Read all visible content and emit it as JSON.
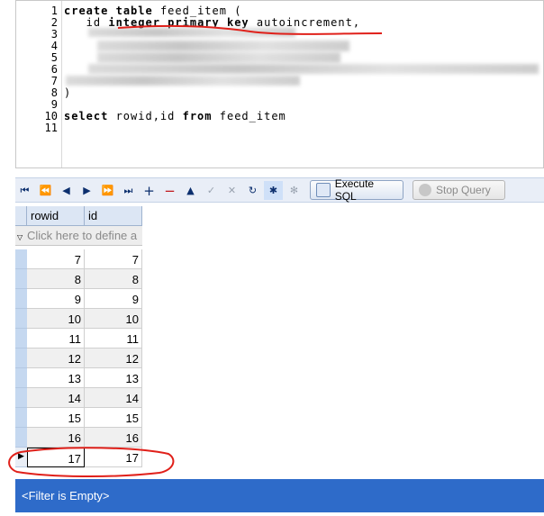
{
  "editor": {
    "lines": [
      {
        "n": "1",
        "parts": [
          {
            "t": "create",
            "k": true
          },
          {
            "t": " "
          },
          {
            "t": "table",
            "k": true
          },
          {
            "t": " feed_item ("
          }
        ]
      },
      {
        "n": "2",
        "parts": [
          {
            "t": "   id "
          },
          {
            "t": "integer",
            "k": true
          },
          {
            "t": " "
          },
          {
            "t": "primary",
            "k": true
          },
          {
            "t": " "
          },
          {
            "t": "key",
            "k": true
          },
          {
            "t": " autoincrement,"
          }
        ]
      },
      {
        "n": "3",
        "parts": []
      },
      {
        "n": "4",
        "parts": []
      },
      {
        "n": "5",
        "parts": []
      },
      {
        "n": "6",
        "parts": []
      },
      {
        "n": "7",
        "parts": []
      },
      {
        "n": "8",
        "parts": [
          {
            "t": ")"
          }
        ]
      },
      {
        "n": "9",
        "parts": []
      },
      {
        "n": "10",
        "parts": [
          {
            "t": "select",
            "k": true
          },
          {
            "t": " rowid,id "
          },
          {
            "t": "from",
            "k": true
          },
          {
            "t": " feed_item"
          }
        ]
      },
      {
        "n": "11",
        "parts": []
      }
    ]
  },
  "toolbar": {
    "nav_icons": [
      "first-icon",
      "prev-page-icon",
      "prev-icon",
      "next-icon",
      "next-page-icon",
      "last-icon",
      "add-icon",
      "delete-icon",
      "up-icon",
      "check-icon",
      "cancel-icon",
      "refresh-icon",
      "asterisk-icon",
      "clear-icon"
    ],
    "execute_label": "Execute SQL",
    "stop_label": "Stop Query"
  },
  "grid": {
    "columns": [
      "rowid",
      "id"
    ],
    "filter_placeholder": "Click here to define a",
    "rows": [
      {
        "rowid": "7",
        "id": "7"
      },
      {
        "rowid": "8",
        "id": "8"
      },
      {
        "rowid": "9",
        "id": "9"
      },
      {
        "rowid": "10",
        "id": "10"
      },
      {
        "rowid": "11",
        "id": "11"
      },
      {
        "rowid": "12",
        "id": "12"
      },
      {
        "rowid": "13",
        "id": "13"
      },
      {
        "rowid": "14",
        "id": "14"
      },
      {
        "rowid": "15",
        "id": "15"
      },
      {
        "rowid": "16",
        "id": "16"
      },
      {
        "rowid": "17",
        "id": "17"
      }
    ]
  },
  "status": {
    "text": "<Filter is Empty>"
  },
  "colors": {
    "status_bar": "#2e6bc9",
    "annotation": "#e0201a",
    "header": "#dce6f4"
  }
}
